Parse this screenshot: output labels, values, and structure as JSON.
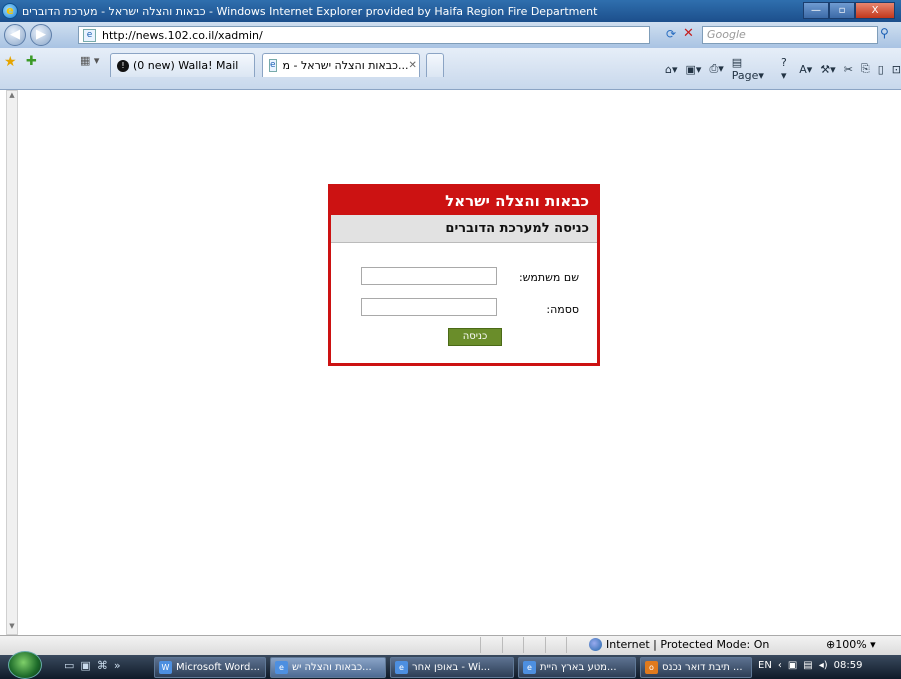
{
  "window": {
    "title": "כבאות והצלה ישראל - מערכת הדוברים - Windows Internet Explorer provided by Haifa Region Fire Department",
    "btn_min": "—",
    "btn_max": "▫",
    "btn_close": "X"
  },
  "address": {
    "url": "http://news.102.co.il/xadmin/",
    "search_placeholder": "Google"
  },
  "tabs": [
    {
      "label": "(0 new) Walla! Mail"
    },
    {
      "label": "כבאות והצלה ישראל - מ..."
    }
  ],
  "commands": {
    "page": "Page"
  },
  "login": {
    "header": "כבאות והצלה ישראל",
    "subheader": "כניסה למערכת הדוברים",
    "username_label": "שם משתמש:",
    "password_label": "ססמה:",
    "submit_label": "כניסה"
  },
  "status": {
    "zone": "Internet | Protected Mode: On",
    "zoom": "100%"
  },
  "taskbar": {
    "items": [
      {
        "label": "Microsoft Word..."
      },
      {
        "label": "כבאות והצלה יש..."
      },
      {
        "label": "באופן אחר - Wi..."
      },
      {
        "label": "מטע בארץ היית..."
      },
      {
        "label": "תיבת דואר נכנס ..."
      }
    ],
    "lang": "EN",
    "clock": "08:59"
  },
  "colors": {
    "accent_red": "#cc1212",
    "button_green": "#6a8d2a"
  }
}
